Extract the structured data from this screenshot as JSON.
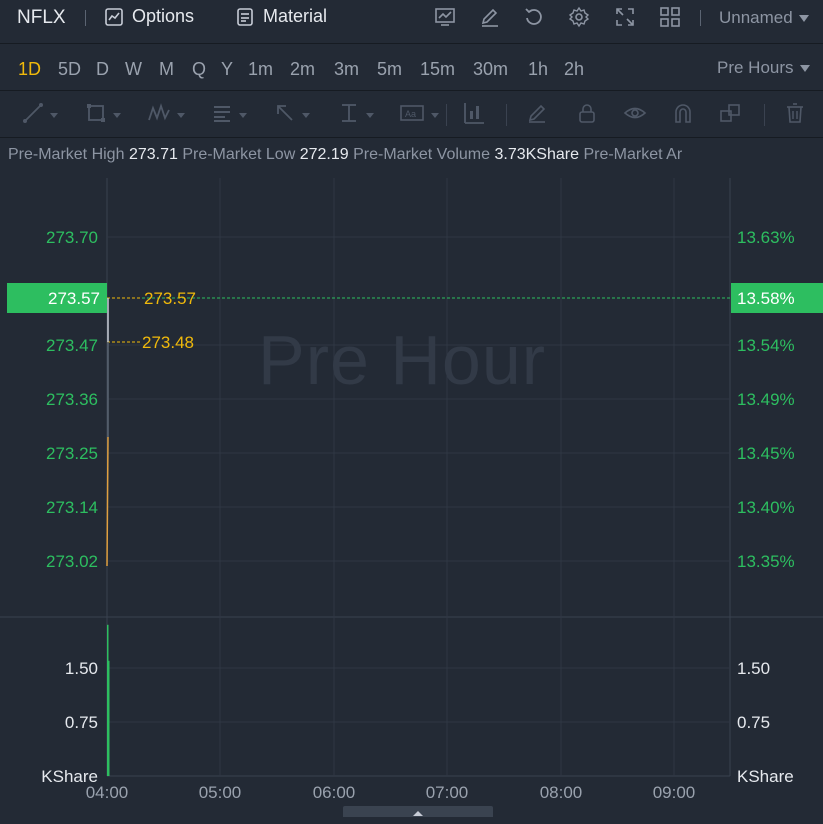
{
  "topbar": {
    "symbol": "NFLX",
    "options_label": "Options",
    "material_label": "Material",
    "layout_name": "Unnamed",
    "icons": [
      "indicators-icon",
      "drawing-edit-icon",
      "reset-icon",
      "settings-icon",
      "fullscreen-icon",
      "layout-grid-icon"
    ]
  },
  "periods": {
    "items": [
      "1D",
      "5D",
      "D",
      "W",
      "M",
      "Q",
      "Y",
      "1m",
      "2m",
      "3m",
      "5m",
      "15m",
      "30m",
      "1h",
      "2h"
    ],
    "active": "1D",
    "session_label": "Pre Hours"
  },
  "drawtools": [
    "trend-line-icon",
    "rectangle-icon",
    "pattern-icon",
    "text-note-icon",
    "arrow-icon",
    "vertical-ruler-icon",
    "text-label-icon",
    "measure-icon",
    "pencil-icon",
    "lock-icon",
    "eye-icon",
    "magnet-icon",
    "clone-icon",
    "trash-icon"
  ],
  "info": {
    "high_label": "Pre-Market High",
    "high_value": "273.71",
    "low_label": "Pre-Market Low",
    "low_value": "272.19",
    "volume_label": "Pre-Market Volume",
    "volume_value": "3.73KShare",
    "amount_label": "Pre-Market Ar"
  },
  "watermark": "Pre Hour",
  "colors": {
    "up": "#2dbe60",
    "accent": "#f0b90b",
    "price_line": "#e0a040",
    "grid": "#2f3744",
    "bg": "#232a35"
  },
  "chart_data": {
    "type": "line",
    "price_axis": {
      "ticks": [
        "273.70",
        "273.47",
        "273.36",
        "273.25",
        "273.14",
        "273.02"
      ],
      "current": "273.57"
    },
    "percent_axis": {
      "ticks": [
        "13.63%",
        "13.58%",
        "13.54%",
        "13.49%",
        "13.45%",
        "13.40%",
        "13.35%"
      ],
      "current": "13.58%"
    },
    "markers": [
      {
        "label": "273.57",
        "price": 273.57
      },
      {
        "label": "273.48",
        "price": 273.48
      }
    ],
    "price_series": [
      {
        "time": "04:00",
        "price": 273.02
      },
      {
        "time": "04:00",
        "price": 273.28
      },
      {
        "time": "04:00",
        "price": 273.48
      },
      {
        "time": "04:00",
        "price": 273.57
      }
    ],
    "volume_axis": {
      "ticks": [
        "1.50",
        "0.75"
      ],
      "unit": "KShare"
    },
    "volume_bars": [
      2.1,
      1.6
    ],
    "x_ticks": [
      "04:00",
      "05:00",
      "06:00",
      "07:00",
      "08:00",
      "09:00"
    ]
  }
}
